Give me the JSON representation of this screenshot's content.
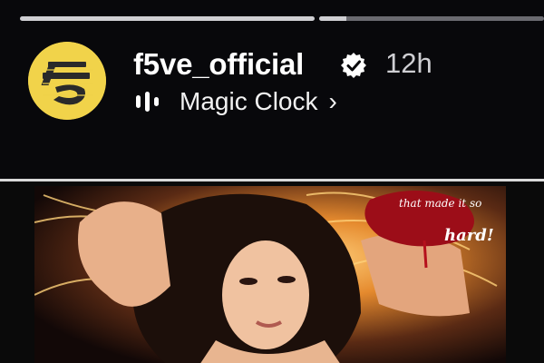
{
  "story": {
    "progress": [
      {
        "fraction": 1.0
      },
      {
        "fraction": 0.12
      }
    ],
    "account": {
      "username": "f5ve_official",
      "verified": true,
      "time_ago": "12h",
      "avatar_icon": "f5ve-logo-icon",
      "avatar_color": "#f1d34a"
    },
    "music": {
      "label": "Magic Clock",
      "icon": "equalizer-icon",
      "chevron": "›"
    }
  },
  "photo": {
    "overlay_text_1": "that made it so",
    "overlay_text_2": "hard!"
  }
}
